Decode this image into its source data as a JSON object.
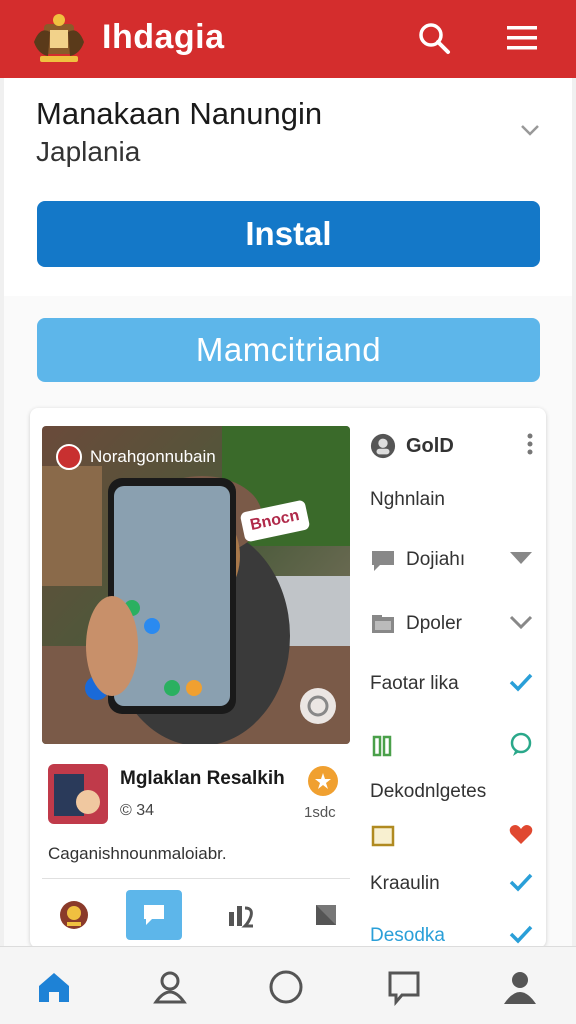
{
  "app": {
    "title": "Ihdagia"
  },
  "header_card": {
    "title": "Manakaan Nanungin",
    "subtitle": "Japlania",
    "install_label": "Instal",
    "manage_label": "Mamcitriand"
  },
  "post": {
    "image_label": "Norahgonnubain",
    "image_badge": "Bnocn",
    "author": "Mglaklan Resalkih",
    "stat": "© 34",
    "time": "1sdc",
    "caption": "Caganishnounmaloiabr."
  },
  "side": {
    "title": "GolD",
    "items": [
      {
        "label": "Nghnlain"
      },
      {
        "label": "Dojiahı"
      },
      {
        "label": "Dpoler"
      },
      {
        "label": "Faotar lika"
      },
      {
        "label": "Dekodnlgetes"
      },
      {
        "label": "Kraaulin"
      },
      {
        "label": "Desodka"
      }
    ]
  },
  "colors": {
    "topbar": "#d42d2d",
    "primary": "#1478c8",
    "secondary": "#5db6ea",
    "accent_check": "#2a9fd8",
    "accent_heart": "#e04830"
  },
  "icons": {
    "top": [
      "search-icon",
      "menu-icon"
    ],
    "bottom_nav": [
      "home-icon",
      "profile-outline-icon",
      "circle-icon",
      "chat-icon",
      "user-icon"
    ]
  }
}
